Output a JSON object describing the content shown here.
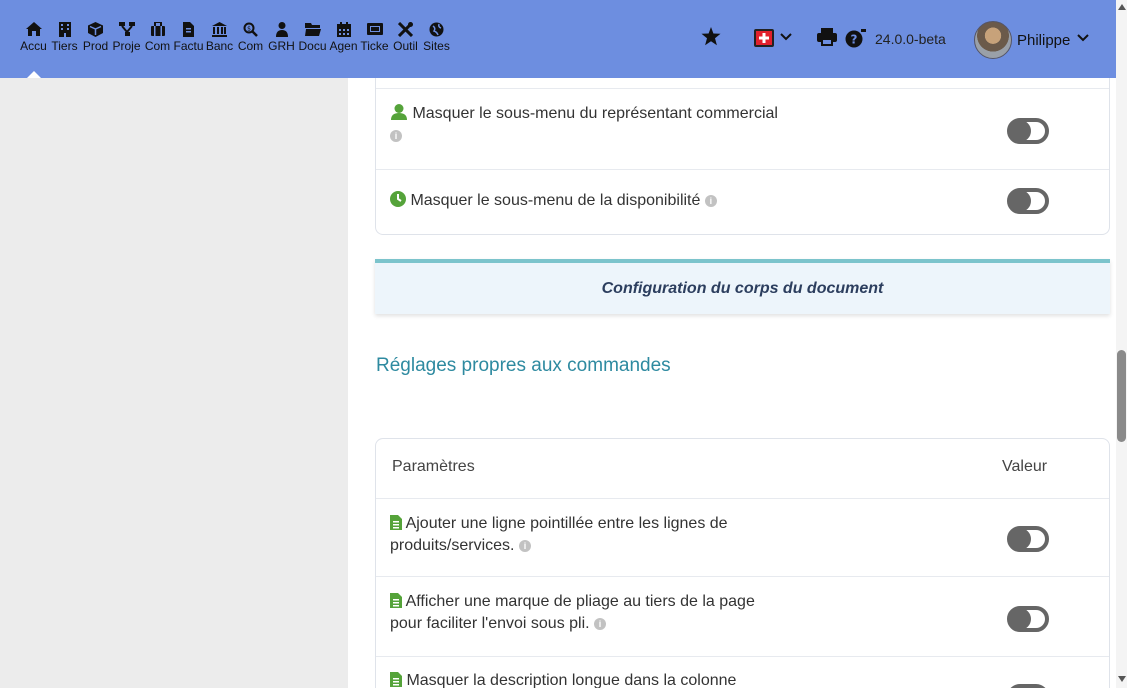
{
  "topbar": {
    "menu": [
      {
        "label": "Accu",
        "icon": "home-icon"
      },
      {
        "label": "Tiers",
        "icon": "building-icon"
      },
      {
        "label": "Prod",
        "icon": "cube-icon"
      },
      {
        "label": "Proje",
        "icon": "sitemap-icon"
      },
      {
        "label": "Com",
        "icon": "briefcase-icon"
      },
      {
        "label": "Factu",
        "icon": "invoice-icon"
      },
      {
        "label": "Banc",
        "icon": "bank-icon"
      },
      {
        "label": "Com",
        "icon": "search-dollar-icon"
      },
      {
        "label": "GRH",
        "icon": "users-icon"
      },
      {
        "label": "Docu",
        "icon": "folder-icon"
      },
      {
        "label": "Agen",
        "icon": "calendar-icon"
      },
      {
        "label": "Ticke",
        "icon": "ticket-icon"
      },
      {
        "label": "Outil",
        "icon": "tools-icon"
      },
      {
        "label": "Sites",
        "icon": "globe-icon"
      }
    ],
    "version": "24.0.0-beta",
    "username": "Philippe"
  },
  "card1": {
    "rows": [
      {
        "text": "Masquer le sous-menu du représentant commercial",
        "icon": "user-icon"
      },
      {
        "text": "Masquer le sous-menu de la disponibilité",
        "icon": "clock-icon"
      }
    ]
  },
  "section": {
    "title": "Configuration du corps du document"
  },
  "subheading": "Réglages propres aux commandes",
  "card2": {
    "header": {
      "param": "Paramètres",
      "value": "Valeur"
    },
    "rows": [
      {
        "line1": "Ajouter une ligne pointillée entre les lignes de",
        "line2": "produits/services."
      },
      {
        "line1": "Afficher une marque de pliage au tiers de la page",
        "line2": "pour faciliter l'envoi sous pli."
      },
      {
        "line1": "Masquer la description longue dans la colonne",
        "line2": ""
      }
    ]
  },
  "colors": {
    "topbar": "#6d8ee0",
    "accent": "#2e8aa0",
    "green": "#55a33a",
    "toggle": "#666666"
  }
}
